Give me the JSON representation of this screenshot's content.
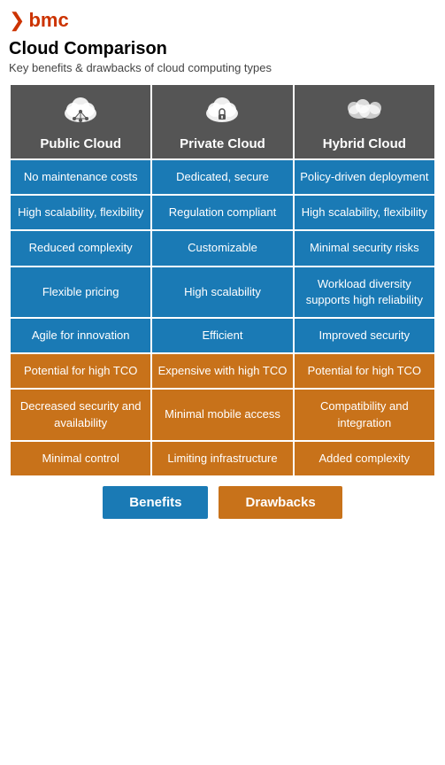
{
  "logo": {
    "symbol": "❯",
    "text": "bmc"
  },
  "title": "Cloud Comparison",
  "subtitle": "Key benefits & drawbacks of cloud computing types",
  "columns": [
    "Public Cloud",
    "Private Cloud",
    "Hybrid Cloud"
  ],
  "icons": [
    "☁",
    "☁",
    "☁"
  ],
  "rows": {
    "benefits": [
      [
        "No maintenance costs",
        "Dedicated, secure",
        "Policy-driven deployment"
      ],
      [
        "High scalability, flexibility",
        "Regulation compliant",
        "High scalability, flexibility"
      ],
      [
        "Reduced complexity",
        "Customizable",
        "Minimal security risks"
      ],
      [
        "Flexible pricing",
        "High scalability",
        "Workload diversity supports high reliability"
      ],
      [
        "Agile for innovation",
        "Efficient",
        "Improved security"
      ]
    ],
    "drawbacks": [
      [
        "Potential for high TCO",
        "Expensive with high TCO",
        "Potential for high TCO"
      ],
      [
        "Decreased security and availability",
        "Minimal mobile access",
        "Compatibility and integration"
      ],
      [
        "Minimal control",
        "Limiting infrastructure",
        "Added complexity"
      ]
    ]
  },
  "footer": {
    "benefits_label": "Benefits",
    "drawbacks_label": "Drawbacks"
  }
}
